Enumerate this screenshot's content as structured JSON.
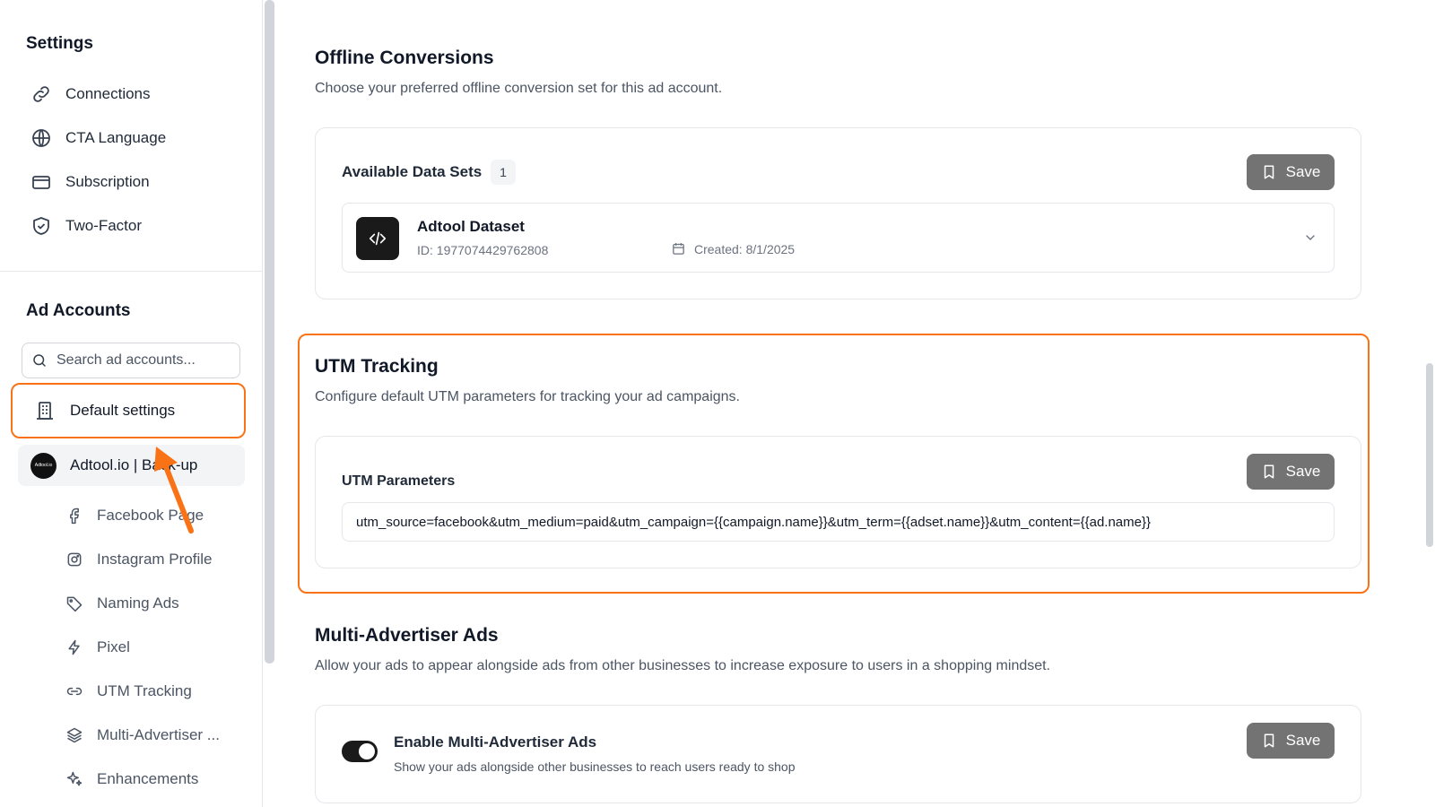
{
  "sidebar": {
    "settings_title": "Settings",
    "settings_items": [
      {
        "label": "Connections",
        "icon": "link-icon"
      },
      {
        "label": "CTA Language",
        "icon": "globe-icon"
      },
      {
        "label": "Subscription",
        "icon": "credit-card-icon"
      },
      {
        "label": "Two-Factor",
        "icon": "shield-check-icon"
      }
    ],
    "ad_accounts_title": "Ad Accounts",
    "search_placeholder": "Search ad accounts...",
    "default_settings_label": "Default settings",
    "account": {
      "name": "Adtool.io | Back-up",
      "avatar_text": "Adtool.io"
    },
    "account_items": [
      {
        "label": "Facebook Page",
        "icon": "facebook-icon"
      },
      {
        "label": "Instagram Profile",
        "icon": "instagram-icon"
      },
      {
        "label": "Naming Ads",
        "icon": "tag-icon"
      },
      {
        "label": "Pixel",
        "icon": "bolt-icon"
      },
      {
        "label": "UTM Tracking",
        "icon": "link-icon"
      },
      {
        "label": "Multi-Advertiser ...",
        "icon": "layers-icon"
      },
      {
        "label": "Enhancements",
        "icon": "sparkles-icon"
      }
    ]
  },
  "offline": {
    "title": "Offline Conversions",
    "description": "Choose your preferred offline conversion set for this ad account.",
    "available_label": "Available Data Sets",
    "count": "1",
    "save_label": "Save",
    "dataset": {
      "name": "Adtool Dataset",
      "id_text": "ID: 1977074429762808",
      "created_text": "Created: 8/1/2025"
    }
  },
  "utm": {
    "title": "UTM Tracking",
    "description": "Configure default UTM parameters for tracking your ad campaigns.",
    "params_label": "UTM Parameters",
    "save_label": "Save",
    "value": "utm_source=facebook&utm_medium=paid&utm_campaign={{campaign.name}}&utm_term={{adset.name}}&utm_content={{ad.name}}"
  },
  "multi": {
    "title": "Multi-Advertiser Ads",
    "description": "Allow your ads to appear alongside ads from other businesses to increase exposure to users in a shopping mindset.",
    "toggle_label": "Enable Multi-Advertiser Ads",
    "toggle_desc": "Show your ads alongside other businesses to reach users ready to shop",
    "save_label": "Save",
    "enabled": true
  },
  "colors": {
    "highlight": "#f97316",
    "save_bg": "#737373"
  }
}
